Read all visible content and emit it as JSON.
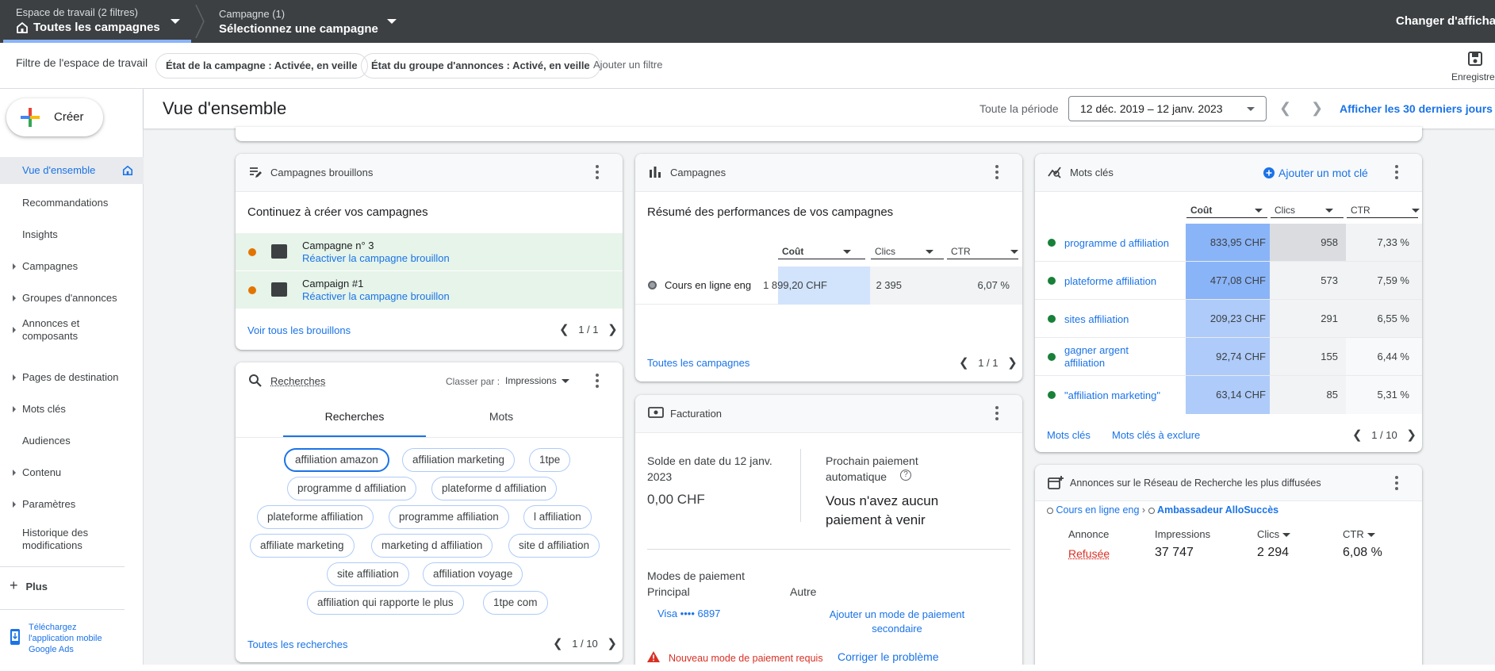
{
  "topbar": {
    "workspace_small": "Espace de travail (2 filtres)",
    "workspace_big": "Toutes les campagnes",
    "campaign_small": "Campagne (1)",
    "campaign_big": "Sélectionnez une campagne",
    "change_view": "Changer d'affichag"
  },
  "filterbar": {
    "label": "Filtre de l'espace de travail",
    "chips": [
      "État de la campagne : Activée, en veille",
      "État du groupe d'annonces : Activé, en veille"
    ],
    "add_filter": "Ajouter un filtre",
    "save_label": "Enregistre"
  },
  "sidebar": {
    "create_label": "Créer",
    "items": [
      {
        "label": "Vue d'ensemble"
      },
      {
        "label": "Recommandations"
      },
      {
        "label": "Insights"
      },
      {
        "label": "Campagnes"
      },
      {
        "label": "Groupes d'annonces"
      },
      {
        "label": "Annonces et\ncomposants"
      },
      {
        "label": "Pages de destination"
      },
      {
        "label": "Mots clés"
      },
      {
        "label": "Audiences"
      },
      {
        "label": "Contenu"
      },
      {
        "label": "Paramètres"
      },
      {
        "label": "Historique des\nmodifications"
      }
    ],
    "more_label": "Plus",
    "app_download": "Téléchargez\nl'application mobile\nGoogle Ads"
  },
  "header": {
    "title": "Vue d'ensemble",
    "period_label": "Toute la période",
    "date_range": "12 déc. 2019 – 12 janv. 2023",
    "last30": "Afficher les 30 derniers jours"
  },
  "drafts": {
    "title": "Campagnes brouillons",
    "subtitle": "Continuez à créer vos campagnes",
    "rows": [
      {
        "name": "Campagne n° 3",
        "link": "Réactiver la campagne brouillon"
      },
      {
        "name": "Campaign #1",
        "link": "Réactiver la campagne brouillon"
      }
    ],
    "footer_link": "Voir tous les brouillons",
    "pager": "1 / 1"
  },
  "campaigns": {
    "title": "Campagnes",
    "subtitle": "Résumé des performances de vos campagnes",
    "headers": [
      "Coût",
      "Clics",
      "CTR"
    ],
    "row": {
      "name": "Cours en ligne eng",
      "cost": "1 899,20 CHF",
      "clicks": "2 395",
      "ctr": "6,07 %"
    },
    "footer_link": "Toutes les campagnes",
    "pager": "1 / 1"
  },
  "keywords": {
    "title": "Mots clés",
    "add_link": "Ajouter un mot clé",
    "headers": [
      "Coût",
      "Clics",
      "CTR"
    ],
    "rows": [
      {
        "name": "programme d affiliation",
        "cost": "833,95 CHF",
        "clicks": "958",
        "ctr": "7,33 %"
      },
      {
        "name": "plateforme affiliation",
        "cost": "477,08 CHF",
        "clicks": "573",
        "ctr": "7,59 %"
      },
      {
        "name": "sites affiliation",
        "cost": "209,23 CHF",
        "clicks": "291",
        "ctr": "6,55 %"
      },
      {
        "name": "gagner argent\naffiliation",
        "cost": "92,74 CHF",
        "clicks": "155",
        "ctr": "6,44 %"
      },
      {
        "name": "\"affiliation marketing\"",
        "cost": "63,14 CHF",
        "clicks": "85",
        "ctr": "5,31 %"
      }
    ],
    "footer_link1": "Mots clés",
    "footer_link2": "Mots clés à exclure",
    "pager": "1 / 10"
  },
  "searches": {
    "title": "Recherches",
    "sort_label": "Classer par :",
    "sort_value": "Impressions",
    "tab1": "Recherches",
    "tab2": "Mots",
    "chips": [
      "affiliation amazon",
      "affiliation marketing",
      "1tpe",
      "programme d affiliation",
      "plateforme d affiliation",
      "plateforme affiliation",
      "programme affiliation",
      "l affiliation",
      "affiliate marketing",
      "marketing d affiliation",
      "site d affiliation",
      "site affiliation",
      "affiliation voyage",
      "affiliation qui rapporte le plus",
      "1tpe com"
    ],
    "footer_link": "Toutes les recherches",
    "pager": "1 / 10"
  },
  "billing": {
    "title": "Facturation",
    "balance_label": "Solde en date du 12 janv.\n2023",
    "balance_value": "0,00 CHF",
    "next_label": "Prochain paiement\nautomatique",
    "next_value": "Vous n'avez aucun\npaiement à venir",
    "modes_label": "Modes de paiement",
    "primary_label": "Principal",
    "other_label": "Autre",
    "primary_value": "Visa •••• 6897",
    "add_secondary": "Ajouter un mode de paiement\nsecondaire",
    "alert_text": "Nouveau mode de paiement requis",
    "fix_link": "Corriger le problème"
  },
  "ads": {
    "title": "Annonces sur le Réseau de Recherche les plus diffusées",
    "crumb1": "Cours en ligne eng",
    "crumb2": "Ambassadeur AlloSuccès",
    "headers": [
      "Annonce",
      "Impressions",
      "Clics",
      "CTR"
    ],
    "row": {
      "status": "Refusée",
      "impressions": "37 747",
      "clicks": "2 294",
      "ctr": "6,08 %"
    }
  },
  "colors": {
    "accent": "#1a73e8",
    "topbar": "#3c4043",
    "draft_bg": "#e6f4ea",
    "status_green": "#188038",
    "error_red": "#d93025"
  }
}
